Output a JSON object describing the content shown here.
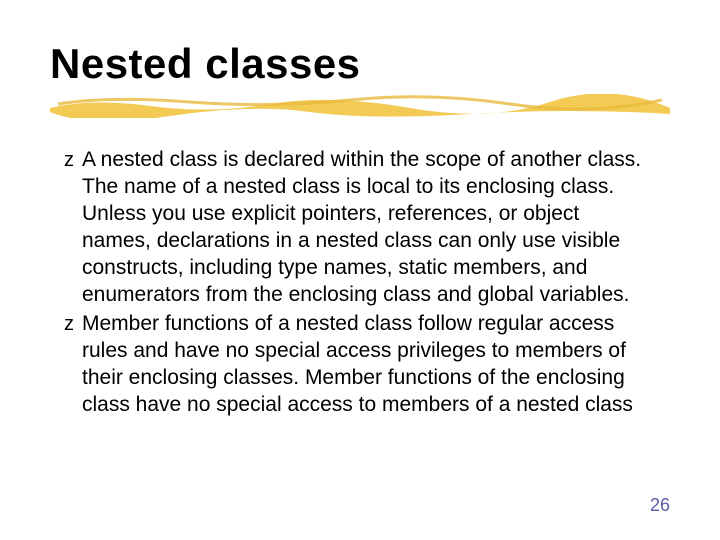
{
  "title": "Nested classes",
  "bullets": [
    "A nested class is declared within the scope of another class. The name of a nested class is local to its enclosing class. Unless you use explicit pointers, references, or object names, declarations in a nested class can only use visible constructs, including type names, static members, and enumerators from the enclosing class and global variables.",
    "Member functions of a nested class follow regular access rules and have no special access privileges to members of their enclosing classes. Member functions of the enclosing class have no special access to members of a nested class"
  ],
  "page_number": "26"
}
